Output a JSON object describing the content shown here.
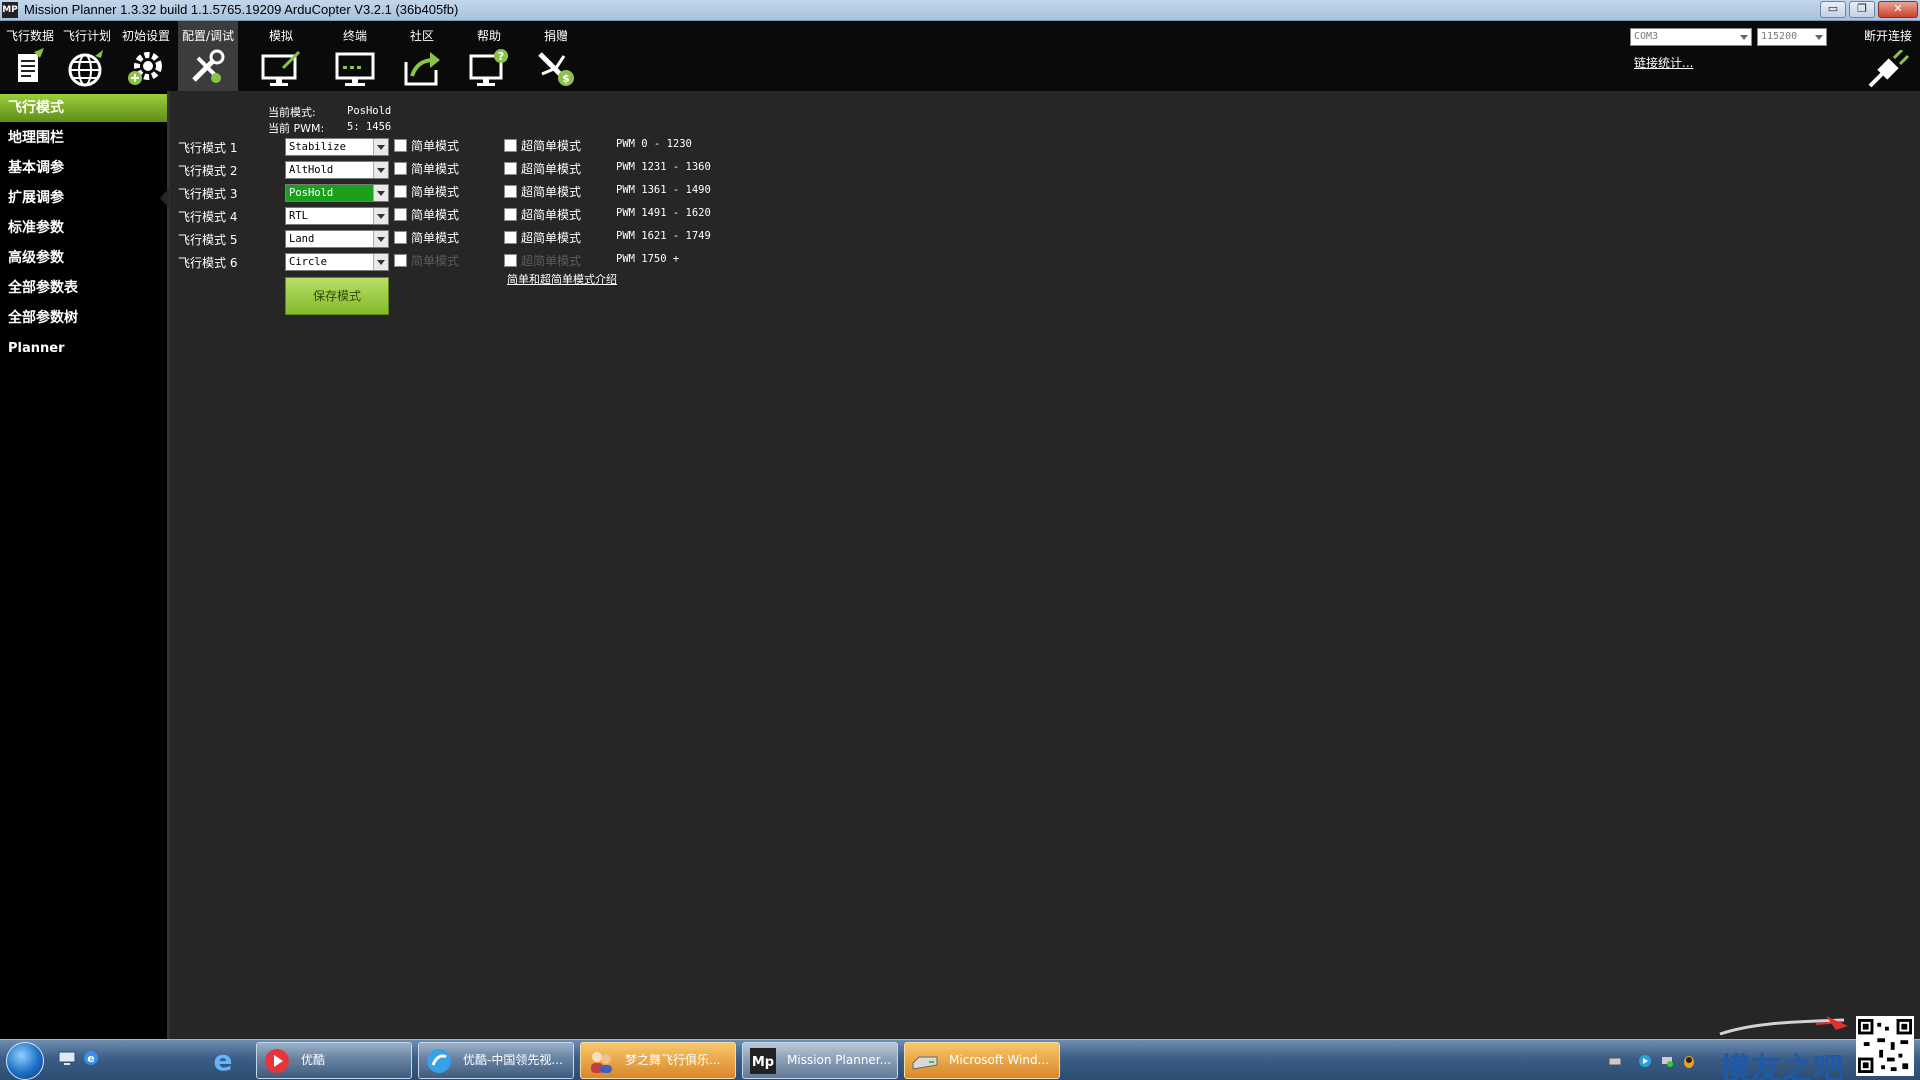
{
  "window": {
    "title": "Mission Planner 1.3.32 build 1.1.5765.19209 ArduCopter V3.2.1 (36b405fb)",
    "app_icon_text": "MP",
    "min_glyph": "▭",
    "max_glyph": "❐",
    "close_glyph": "✕"
  },
  "toolbar": {
    "items": [
      {
        "label": "飞行数据",
        "icon": "flight-data-icon"
      },
      {
        "label": "飞行计划",
        "icon": "flight-plan-icon"
      },
      {
        "label": "初始设置",
        "icon": "initial-setup-icon"
      },
      {
        "label": "配置/调试",
        "icon": "config-tuning-icon",
        "active": true
      },
      {
        "label": "模拟",
        "icon": "simulation-icon"
      },
      {
        "label": "终端",
        "icon": "terminal-icon"
      },
      {
        "label": "社区",
        "icon": "community-icon"
      },
      {
        "label": "帮助",
        "icon": "help-icon"
      },
      {
        "label": "捐赠",
        "icon": "donate-icon"
      }
    ],
    "com_port": "COM3",
    "baud_rate": "115200",
    "link_stats": "链接统计...",
    "disconnect": "断开连接"
  },
  "sidebar": {
    "items": [
      {
        "label": "飞行模式",
        "active": true
      },
      {
        "label": "地理围栏"
      },
      {
        "label": "基本调参"
      },
      {
        "label": "扩展调参"
      },
      {
        "label": "标准参数"
      },
      {
        "label": "高级参数"
      },
      {
        "label": "全部参数表"
      },
      {
        "label": "全部参数树"
      },
      {
        "label": "Planner"
      }
    ]
  },
  "flight_modes": {
    "current_mode_label": "当前模式:",
    "current_mode_value": "PosHold",
    "current_pwm_label": "当前 PWM:",
    "current_pwm_value": "5: 1456",
    "simple_label": "简单模式",
    "super_simple_label": "超简单模式",
    "rows": [
      {
        "label": "飞行模式 1",
        "mode": "Stabilize",
        "pwm": "PWM 0 - 1230"
      },
      {
        "label": "飞行模式 2",
        "mode": "AltHold",
        "pwm": "PWM 1231 - 1360"
      },
      {
        "label": "飞行模式 3",
        "mode": "PosHold",
        "pwm": "PWM 1361 - 1490",
        "highlight": true
      },
      {
        "label": "飞行模式 4",
        "mode": "RTL",
        "pwm": "PWM 1491 - 1620"
      },
      {
        "label": "飞行模式 5",
        "mode": "Land",
        "pwm": "PWM 1621 - 1749"
      },
      {
        "label": "飞行模式 6",
        "mode": "Circle",
        "pwm": "PWM 1750 +",
        "disabled": true
      }
    ],
    "save_button": "保存模式",
    "help_link": "简单和超简单模式介绍"
  },
  "taskbar": {
    "tasks": [
      {
        "label": "优酷"
      },
      {
        "label": "优酷-中国领先视..."
      },
      {
        "label": "梦之舞飞行俱乐..."
      },
      {
        "label": "Mission Planner..."
      },
      {
        "label": "Microsoft Wind..."
      }
    ],
    "watermark": "模友之吧"
  },
  "colors": {
    "sidebar_active": "#7fb02a",
    "mode_highlight": "#1aa01a",
    "save_button": "#a4d04a"
  }
}
